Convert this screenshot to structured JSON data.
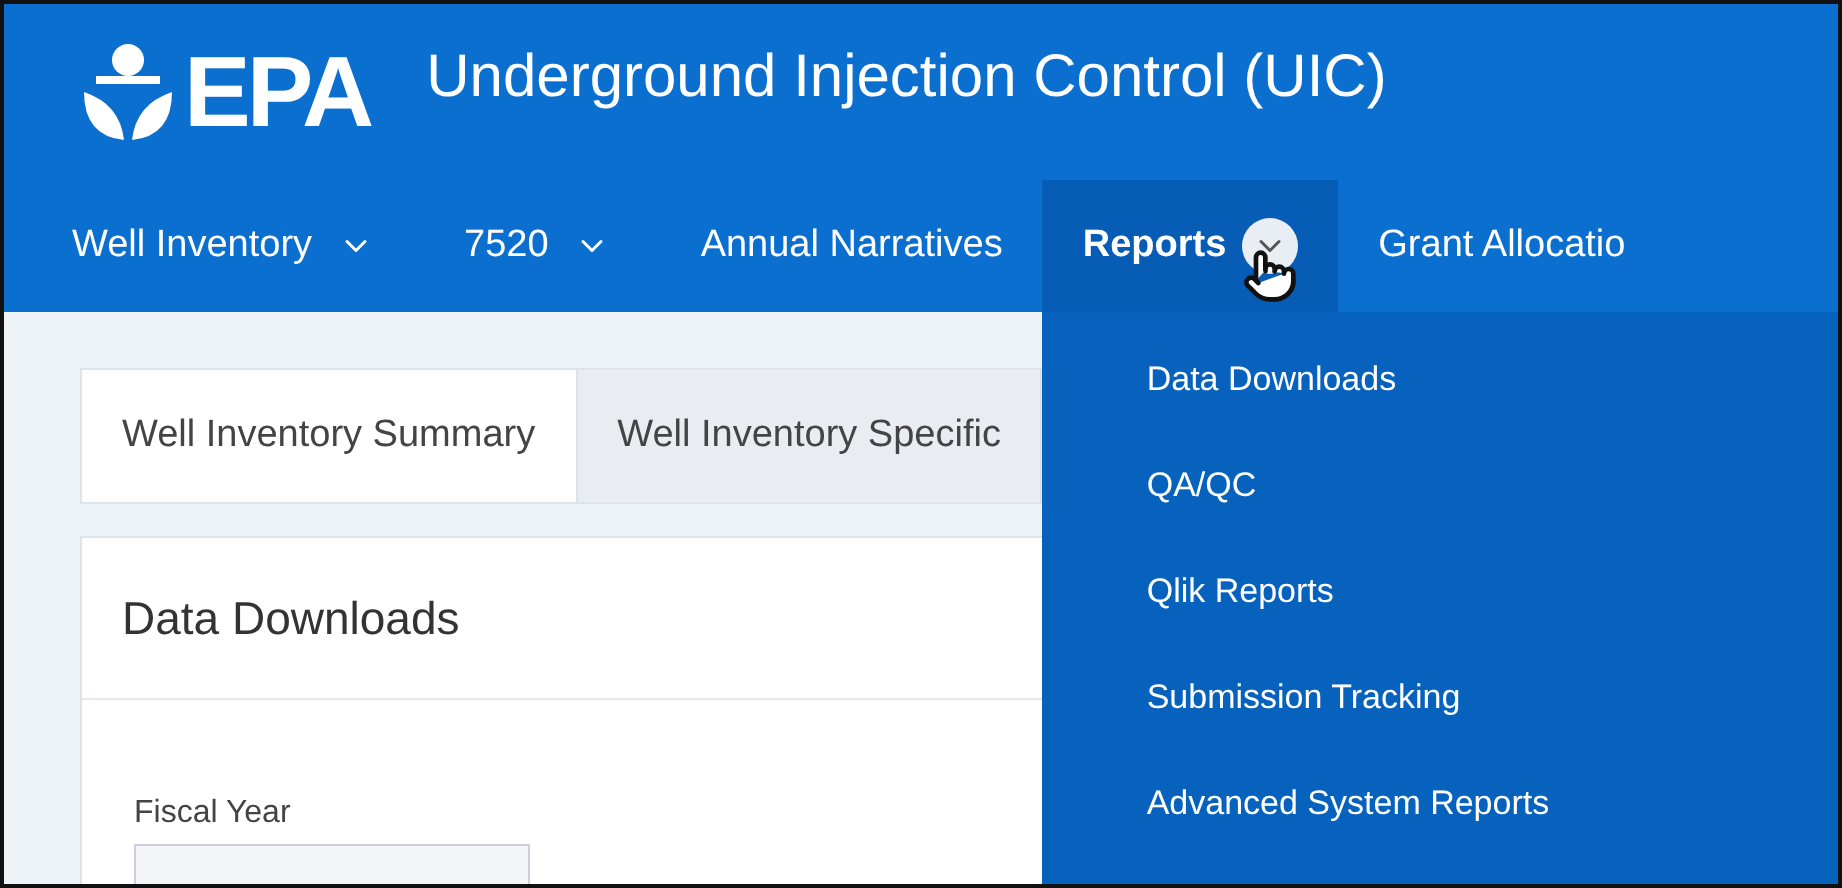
{
  "header": {
    "logo": "EPA",
    "title": "Underground Injection Control (UIC)"
  },
  "nav": [
    {
      "label": "Well Inventory",
      "has_menu": true,
      "selected": false
    },
    {
      "label": "7520",
      "has_menu": true,
      "selected": false
    },
    {
      "label": "Annual Narratives",
      "has_menu": false,
      "selected": false
    },
    {
      "label": "Reports",
      "has_menu": true,
      "selected": true,
      "menu": [
        "Data Downloads",
        "QA/QC",
        "Qlik Reports",
        "Submission Tracking",
        "Advanced System Reports"
      ]
    },
    {
      "label": "Grant Allocatio",
      "has_menu": false,
      "selected": false
    }
  ],
  "tabs": [
    {
      "label": "Well Inventory Summary",
      "selected": true
    },
    {
      "label": "Well Inventory Specific",
      "selected": false
    }
  ],
  "panel": {
    "title": "Data Downloads",
    "field_label": "Fiscal Year"
  }
}
